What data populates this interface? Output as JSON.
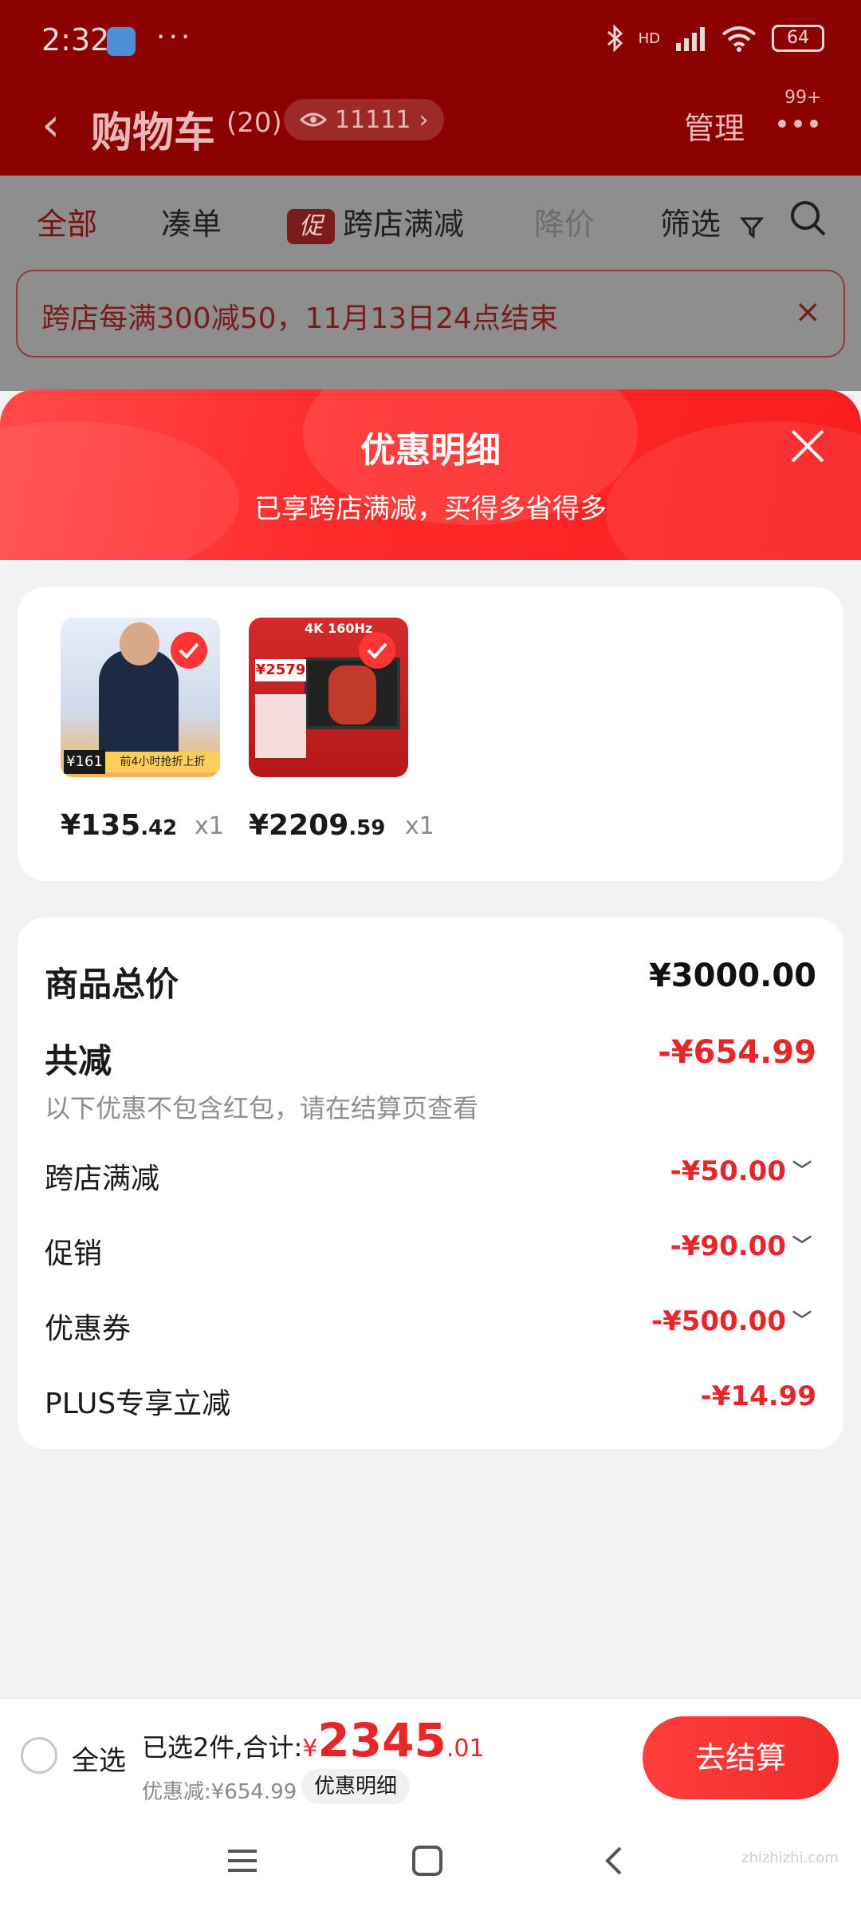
{
  "status_bar": {
    "time": "2:32",
    "dots": "···",
    "network": "HD",
    "battery": "64"
  },
  "header": {
    "back_label": "‹",
    "title": "购物车",
    "count": "(20)",
    "watch_count": "11111",
    "watch_chevron": "›",
    "manage": "管理",
    "more_badge": "99+"
  },
  "tabs": [
    {
      "label": "全部",
      "state": "active"
    },
    {
      "label": "凑单",
      "state": "normal"
    },
    {
      "label": "跨店满减",
      "badge": "促",
      "state": "normal"
    },
    {
      "label": "降价",
      "state": "disabled"
    },
    {
      "label": "筛选",
      "state": "normal"
    }
  ],
  "promo_banner": {
    "text": "跨店每满300减50，11月13日24点结束",
    "close": "×"
  },
  "sheet": {
    "title": "优惠明细",
    "subtitle": "已享跨店满减，买得多省得多"
  },
  "products": [
    {
      "price_int": "¥135",
      "price_dec": ".42",
      "qty": "x1",
      "thumb_tag": "¥161",
      "thumb_band": "前4小时抢折上折"
    },
    {
      "price_int": "¥2209",
      "price_dec": ".59",
      "qty": "x1",
      "thumb_tag": "¥2579",
      "thumb_band": "4K 160Hz"
    }
  ],
  "summary": {
    "total_label": "商品总价",
    "total_value": "¥3000.00",
    "minus_label": "共减",
    "minus_value": "-¥654.99",
    "note": "以下优惠不包含红包，请在结算页查看",
    "items": [
      {
        "label": "跨店满减",
        "value": "-¥50.00",
        "chevron": "﹀"
      },
      {
        "label": "促销",
        "value": "-¥90.00",
        "chevron": "﹀"
      },
      {
        "label": "优惠券",
        "value": "-¥500.00",
        "chevron": "﹀"
      },
      {
        "label": "PLUS专享立减",
        "value": "-¥14.99"
      }
    ]
  },
  "action_bar": {
    "select_all": "全选",
    "selected_text": "已选2件,合计:",
    "currency": "¥",
    "total_int": "2345",
    "total_dec": ".01",
    "discount_text": "优惠减:¥654.99",
    "detail_chip": "优惠明细",
    "checkout": "去结算"
  },
  "watermark": "zhizhizhi.com",
  "colors": {
    "accent_red": "#e8262a",
    "header_dim_red": "#8b0000",
    "sheet_gradient_start": "#ff4a4a",
    "sheet_gradient_end": "#fa1e1e"
  }
}
